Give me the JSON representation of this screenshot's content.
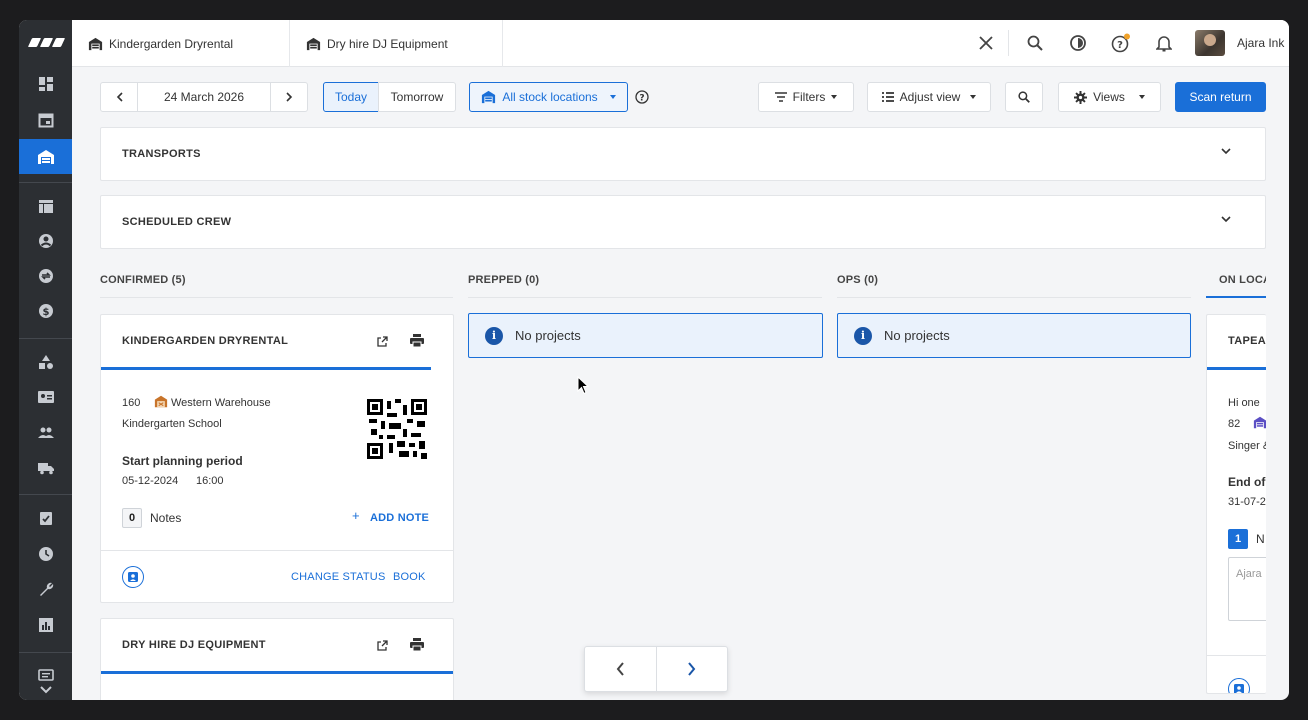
{
  "tabs": [
    {
      "label": "Kindergarden Dryrental"
    },
    {
      "label": "Dry hire DJ Equipment"
    }
  ],
  "user": {
    "name": "Ajara Ink"
  },
  "toolbar": {
    "date": "24 March 2026",
    "today": "Today",
    "tomorrow": "Tomorrow",
    "locations": "All stock locations",
    "filters": "Filters",
    "adjust_view": "Adjust view",
    "views": "Views",
    "scan_return": "Scan return"
  },
  "sections": {
    "transports": "TRANSPORTS",
    "scheduled_crew": "SCHEDULED CREW"
  },
  "columns": [
    {
      "label": "CONFIRMED (5)"
    },
    {
      "label": "PREPPED (0)"
    },
    {
      "label": "OPS (0)"
    },
    {
      "label": "ON LOCA"
    }
  ],
  "empty_state": "No projects",
  "card1": {
    "title": "KINDERGARDEN DRYRENTAL",
    "number": "160",
    "location": "Western Warehouse",
    "client": "Kindergarten School",
    "period_label": "Start planning period",
    "date": "05-12-2024",
    "time": "16:00",
    "notes_count": "0",
    "notes_label": "Notes",
    "add_note": "ADD NOTE",
    "change_status": "CHANGE STATUS",
    "book": "BOOK"
  },
  "card2": {
    "title": "DRY HIRE DJ EQUIPMENT"
  },
  "card3": {
    "title": "TAPEAC",
    "line1": "Hi one",
    "number": "82",
    "client": "Singer &",
    "period_label": "End of",
    "date": "31-07-2",
    "notes_count": "1",
    "notes_label": "N",
    "note_placeholder": "Ajara"
  },
  "colors": {
    "accent": "#1a6fd8",
    "sidebar": "#2c2f33",
    "info_bg": "#eaf2fc"
  }
}
